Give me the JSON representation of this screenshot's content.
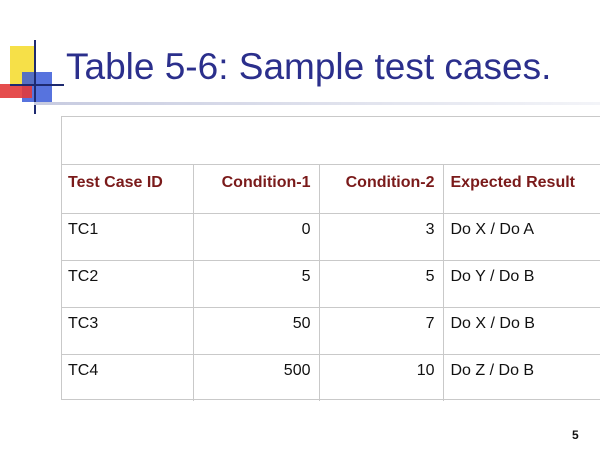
{
  "slide": {
    "title": "Table 5-6: Sample test cases.",
    "page_number": "5"
  },
  "table": {
    "headers": [
      "Test Case ID",
      "Condition-1",
      "Condition-2",
      "Expected Result"
    ],
    "rows": [
      [
        "TC1",
        "0",
        "3",
        "Do X / Do A"
      ],
      [
        "TC2",
        "5",
        "5",
        "Do Y / Do B"
      ],
      [
        "TC3",
        "50",
        "7",
        "Do X / Do B"
      ],
      [
        "TC4",
        "500",
        "10",
        "Do Z / Do B"
      ]
    ]
  },
  "colors": {
    "title": "#2b2f8c",
    "header_text": "#7a1a1a",
    "grid_lines": "#c9c9c9"
  }
}
